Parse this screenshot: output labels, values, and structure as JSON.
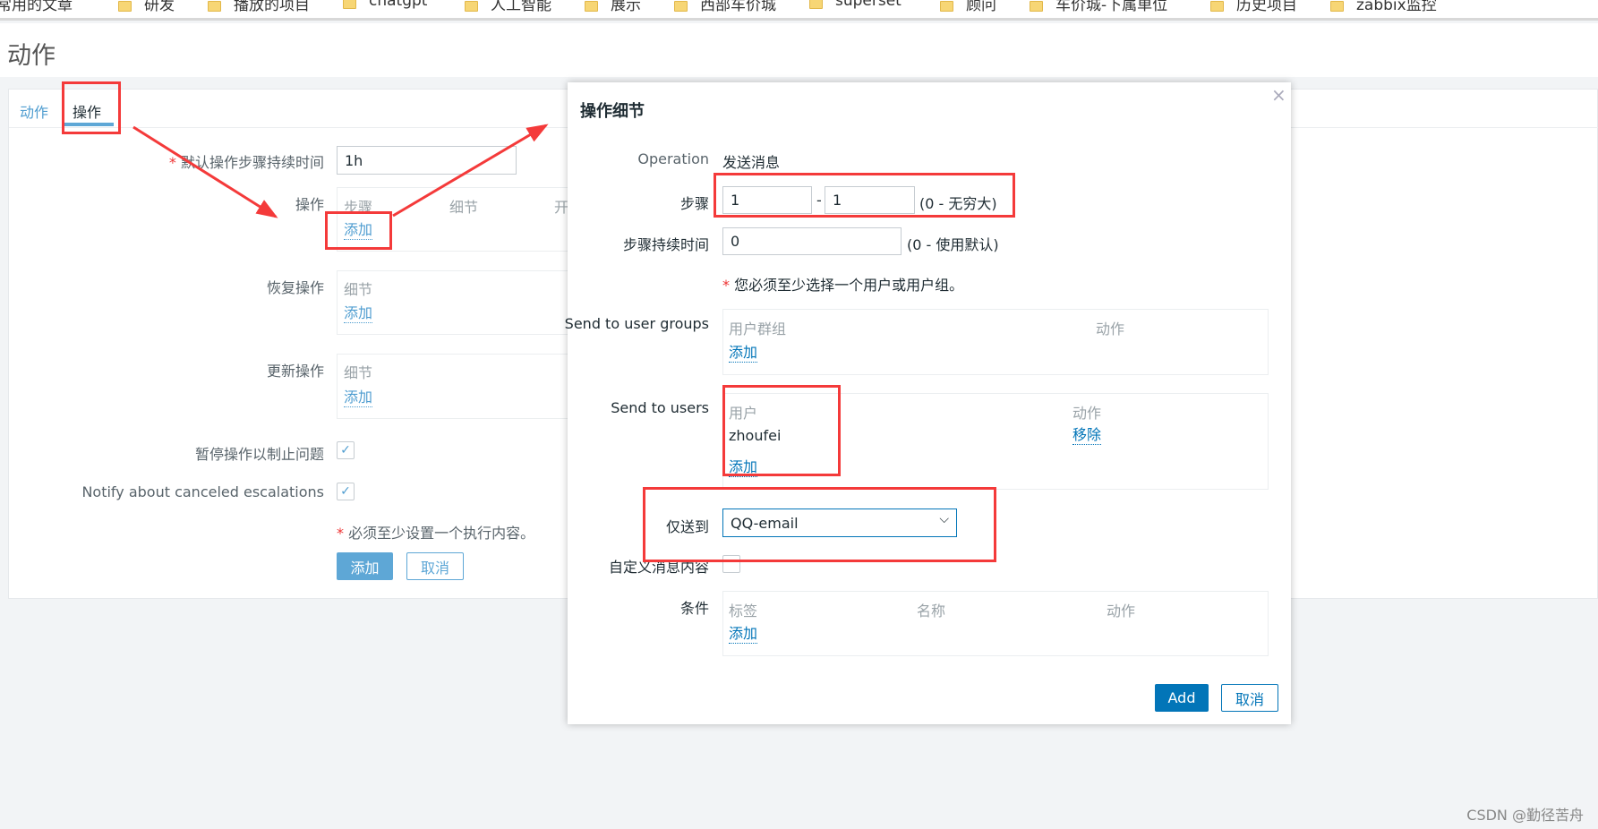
{
  "bookmarks": [
    "常用的文章",
    "研发",
    "播放的项目",
    "chatgpt",
    "人工智能",
    "展示",
    "西部车价城",
    "superset",
    "顾问",
    "车价城-下属单位",
    "历史项目",
    "zabbix监控"
  ],
  "page_title": "动作",
  "tabs": [
    {
      "label": "动作",
      "active": false
    },
    {
      "label": "操作",
      "active": true
    }
  ],
  "form": {
    "default_duration_label": "默认操作步骤持续时间",
    "default_duration_value": "1h",
    "operations_label": "操作",
    "operations_cols": [
      "步骤",
      "细节",
      "开"
    ],
    "add": "添加",
    "recovery_label": "恢复操作",
    "recovery_col": "细节",
    "update_label": "更新操作",
    "update_col": "细节",
    "pause_label": "暂停操作以制止问题",
    "pause_checked": true,
    "notify_label": "Notify about canceled escalations",
    "notify_checked": true,
    "required_msg": "必须至少设置一个执行内容。",
    "add_button": "添加",
    "cancel_button": "取消"
  },
  "dialog": {
    "title": "操作细节",
    "close": "×",
    "operation_label": "Operation",
    "operation_value": "发送消息",
    "steps_label": "步骤",
    "step_from": "1",
    "step_to": "1",
    "steps_hint": "(0 - 无穷大)",
    "step_duration_label": "步骤持续时间",
    "step_duration_value": "0",
    "step_duration_hint": "(0 - 使用默认)",
    "must_select_msg": "您必须至少选择一个用户或用户组。",
    "user_groups_label": "Send to user groups",
    "user_groups_cols": [
      "用户群组",
      "动作"
    ],
    "users_label": "Send to users",
    "users_cols": [
      "用户",
      "动作"
    ],
    "users": [
      {
        "name": "zhoufei",
        "action": "移除"
      }
    ],
    "send_only_to_label": "仅送到",
    "send_only_to_value": "QQ-email",
    "custom_message_label": "自定义消息内容",
    "custom_message_checked": false,
    "conditions_label": "条件",
    "conditions_cols": [
      "标签",
      "名称",
      "动作"
    ],
    "add_link": "添加",
    "add_button": "Add",
    "cancel_button": "取消"
  },
  "watermark": "CSDN @勤径苦舟",
  "colors": {
    "accent": "#0275b8",
    "annotation": "#f43a3a",
    "primary_disabled": "#5ea7d6"
  }
}
